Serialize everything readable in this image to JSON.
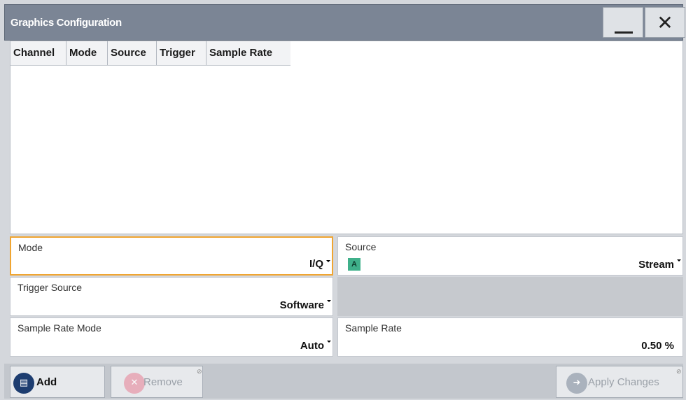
{
  "window": {
    "title": "Graphics Configuration",
    "minimize_icon": "minimize-icon",
    "close_icon": "close-icon",
    "close_glyph": "✕"
  },
  "table": {
    "columns": [
      "Channel",
      "Mode",
      "Source",
      "Trigger",
      "Sample Rate"
    ],
    "rows": []
  },
  "fields": {
    "mode": {
      "label": "Mode",
      "value": "I/Q"
    },
    "source": {
      "label": "Source",
      "badge": "A",
      "value": "Stream"
    },
    "trigger_source": {
      "label": "Trigger Source",
      "value": "Software"
    },
    "sample_rate_mode": {
      "label": "Sample Rate Mode",
      "value": "Auto"
    },
    "sample_rate": {
      "label": "Sample Rate",
      "value": "0.50 %"
    }
  },
  "buttons": {
    "add": "Add",
    "remove": "Remove",
    "apply": "Apply Changes"
  },
  "colors": {
    "titlebar": "#7b8595",
    "focus_border": "#f0a531",
    "badge": "#3fb08a",
    "add_icon": "#1d3d70"
  }
}
